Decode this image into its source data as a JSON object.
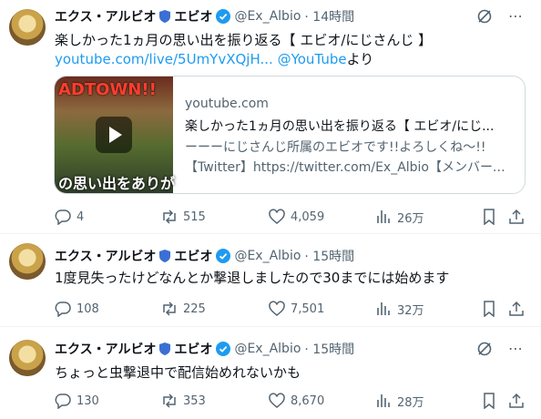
{
  "tweets": [
    {
      "name": "エクス・アルビオ",
      "name_suffix": "エビオ",
      "handle": "@Ex_Albio",
      "time": "· 14時間",
      "text": "楽しかった1ヵ月の思い出を振り返る【 エビオ/にじさんじ 】",
      "link": "youtube.com/live/5UmYvXQjH...",
      "mention": "@YouTube",
      "suffix": "より",
      "card": {
        "thumb_top": "ADTOWN!!",
        "thumb_bottom": "の思い出をありが",
        "domain": "youtube.com",
        "title": "楽しかった1ヵ月の思い出を振り返る【 エビオ/にじ...",
        "desc1": "ーーーにじさんじ所属のエビオです!!よろしくね～!!",
        "desc2": "【Twitter】https://twitter.com/Ex_Albio【メンバーシ..."
      },
      "replies": "4",
      "retweets": "515",
      "likes": "4,059",
      "views": "26万"
    },
    {
      "name": "エクス・アルビオ",
      "name_suffix": "エビオ",
      "handle": "@Ex_Albio",
      "time": "· 15時間",
      "text": "1度見失ったけどなんとか撃退しましたので30までには始めます",
      "replies": "108",
      "retweets": "225",
      "likes": "7,501",
      "views": "32万"
    },
    {
      "name": "エクス・アルビオ",
      "name_suffix": "エビオ",
      "handle": "@Ex_Albio",
      "time": "· 15時間",
      "text": "ちょっと虫撃退中で配信始めれないかも",
      "replies": "130",
      "retweets": "353",
      "likes": "8,670",
      "views": "28万"
    }
  ],
  "colors": {
    "accent": "#1d9bf0",
    "muted": "#536471",
    "shield": "#3b6fd4"
  }
}
